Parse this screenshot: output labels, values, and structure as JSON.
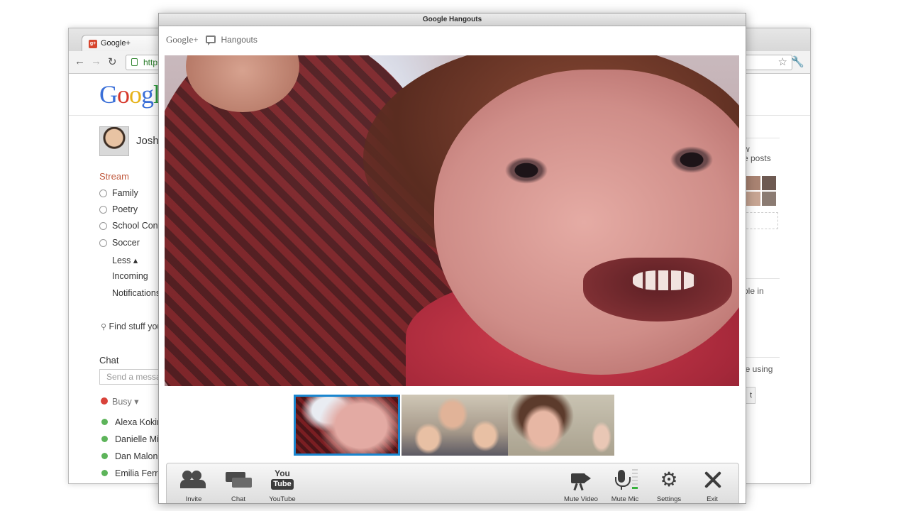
{
  "browser": {
    "tab_title": "Google+",
    "url": "https",
    "logo": "Google",
    "profile_name": "Josh",
    "stream_title": "Stream",
    "circles": [
      "Family",
      "Poetry",
      "School Conta",
      "Soccer"
    ],
    "less_label": "Less ▴",
    "incoming_label": "Incoming",
    "notifications_label": "Notifications",
    "find_label": "Find stuff you",
    "chat_title": "Chat",
    "chat_placeholder": "Send a messa",
    "busy_label": "Busy ▾",
    "contacts": [
      "Alexa Kokin",
      "Danielle Mir",
      "Dan Malone",
      "Emilia Ferre"
    ],
    "right_fragments": {
      "w": "w",
      "posts": "e posts",
      "people": "ble in",
      "using": "cle using",
      "button": "t"
    }
  },
  "hangout": {
    "window_title": "Google Hangouts",
    "brand_gplus": "Google+",
    "brand_hangouts": "Hangouts",
    "toolbar": {
      "invite": "Invite",
      "chat": "Chat",
      "youtube_top": "You",
      "youtube_bottom": "Tube",
      "youtube": "YouTube",
      "mute_video": "Mute Video",
      "mute_mic": "Mute Mic",
      "settings": "Settings",
      "exit": "Exit"
    },
    "selected_thumbnail": 1,
    "mic_level_bars_on": 1,
    "accent_color": "#1a86cf"
  }
}
